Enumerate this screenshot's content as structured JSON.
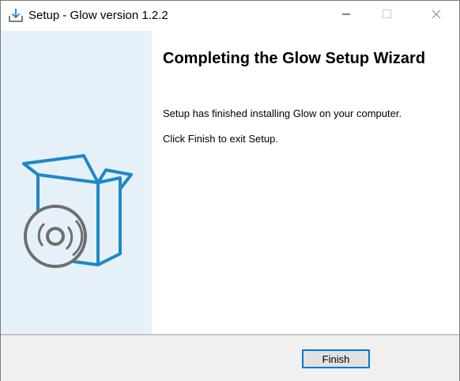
{
  "window": {
    "title": "Setup - Glow version 1.2.2"
  },
  "icons": {
    "app": "setup-download-icon",
    "box": "software-box-icon",
    "disc": "cd-disc-icon"
  },
  "colors": {
    "accent": "#0078d7",
    "sidebar_bg": "#e6f0f8",
    "box_stroke": "#1e88c8",
    "disc_stroke": "#6e6e6e"
  },
  "main": {
    "heading": "Completing the Glow Setup Wizard",
    "line1": "Setup has finished installing Glow on your computer.",
    "line2": "Click Finish to exit Setup."
  },
  "footer": {
    "finish_label": "Finish"
  }
}
